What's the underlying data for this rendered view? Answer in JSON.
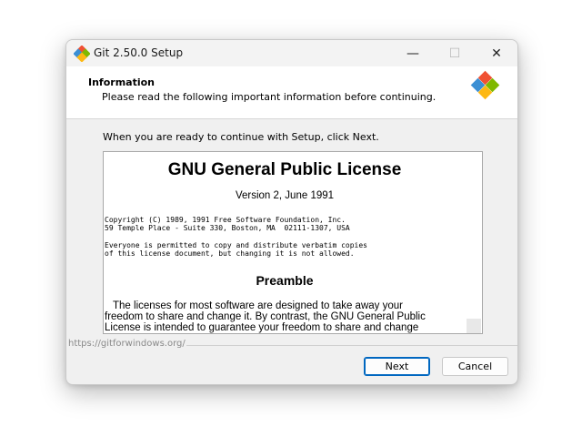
{
  "window": {
    "title": "Git 2.50.0 Setup",
    "controls": {
      "minimize": "—",
      "maximize": "☐",
      "close": "✕"
    }
  },
  "header": {
    "title": "Information",
    "subtitle": "Please read the following important information before continuing."
  },
  "intro": "When you are ready to continue with Setup, click Next.",
  "license": {
    "title": "GNU General Public License",
    "version": "Version 2, June 1991",
    "copyright_1": "Copyright (C) 1989, 1991 Free Software Foundation, Inc.",
    "copyright_2": "59 Temple Place - Suite 330, Boston, MA  02111-1307, USA",
    "permission_1": "Everyone is permitted to copy and distribute verbatim copies",
    "permission_2": "of this license document, but changing it is not allowed.",
    "preamble_heading": "Preamble",
    "body_1": "The licenses for most software are designed to take away your",
    "body_2": "freedom to share and change it. By contrast, the GNU General Public",
    "body_3": "License is intended to guarantee your freedom to share and change"
  },
  "footer": {
    "link": "https://gitforwindows.org/"
  },
  "buttons": {
    "next": "Next",
    "cancel": "Cancel"
  },
  "icons": {
    "app": "git-logo-icon",
    "header": "git-logo-icon"
  },
  "colors": {
    "accent": "#0067c0",
    "git_orange": "#f05133",
    "git_green": "#7fb800",
    "git_blue": "#3b8fd4",
    "git_yellow": "#fdb813"
  }
}
